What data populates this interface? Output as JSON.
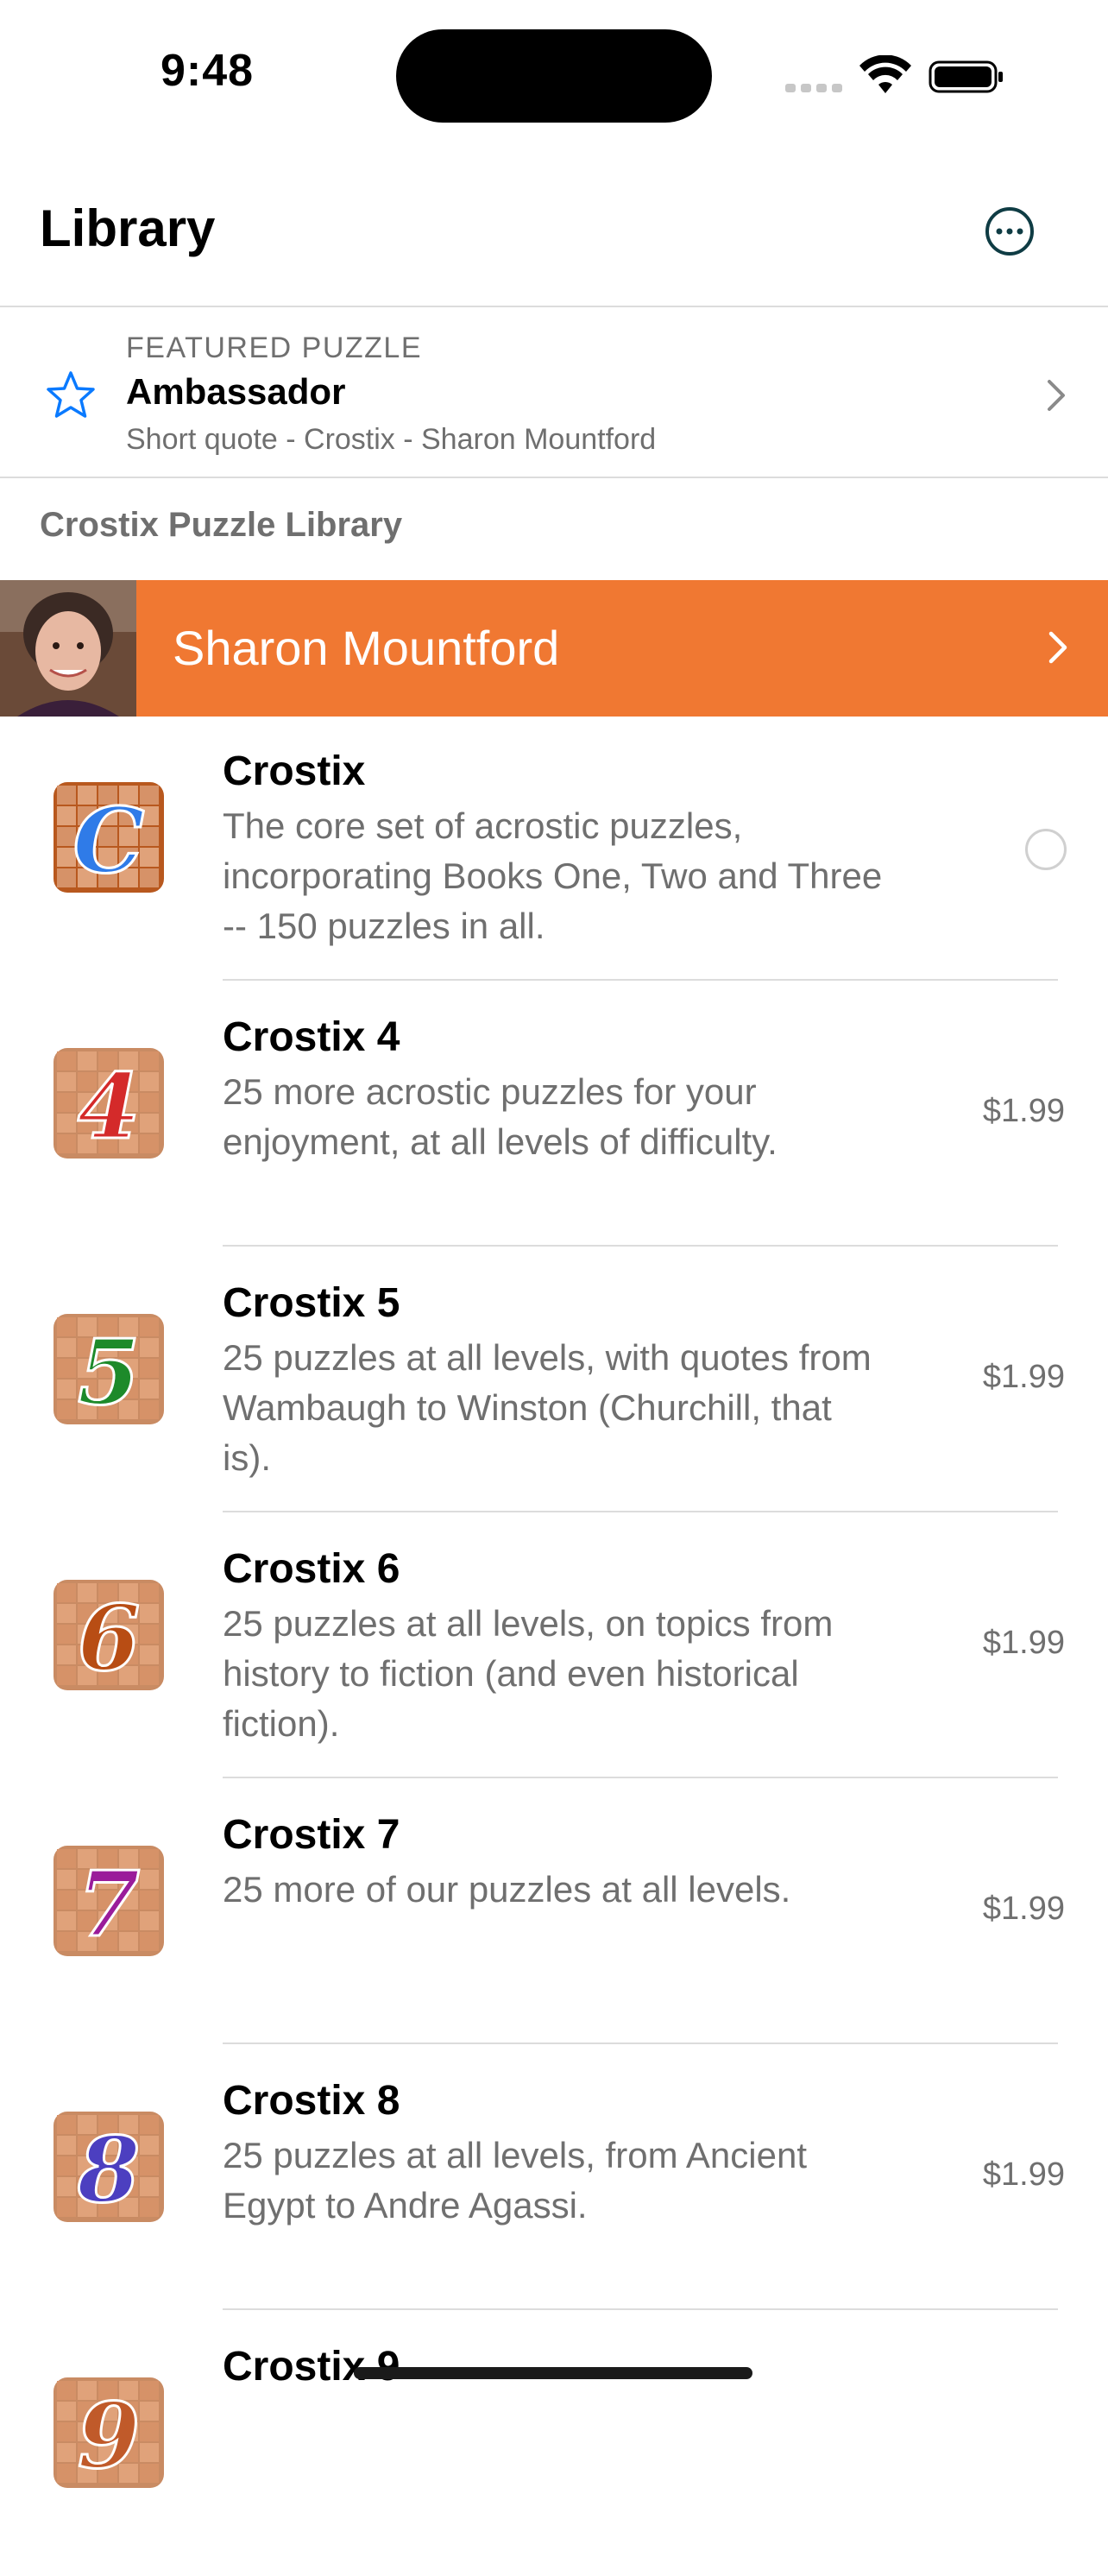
{
  "status_bar": {
    "time": "9:48"
  },
  "nav": {
    "title": "Library",
    "more_icon": "ellipsis-circle-icon"
  },
  "featured": {
    "kicker": "FEATURED PUZZLE",
    "title": "Ambassador",
    "subtitle": "Short quote - Crostix - Sharon Mountford",
    "icon": "star-icon"
  },
  "section": {
    "label": "Crostix Puzzle Library"
  },
  "author": {
    "name": "Sharon Mountford"
  },
  "colors": {
    "accent_orange": "#f07832",
    "link_blue": "#0a7aff"
  },
  "items": [
    {
      "title": "Crostix",
      "desc_lines": [
        "The core set of acrostic puzzles,",
        "incorporating Books One, Two and Three",
        "-- 150 puzzles in all."
      ],
      "price": "",
      "badge": "C",
      "badge_color": "#2f7be8"
    },
    {
      "title": "Crostix 4",
      "desc_lines": [
        "25 more acrostic puzzles for your",
        "enjoyment, at all levels of difficulty."
      ],
      "price": "$1.99",
      "badge": "4",
      "badge_color": "#d42a2a"
    },
    {
      "title": "Crostix 5",
      "desc_lines": [
        "25 puzzles at all levels, with quotes from",
        "Wambaugh to Winston (Churchill, that",
        "is)."
      ],
      "price": "$1.99",
      "badge": "5",
      "badge_color": "#1d8a2a"
    },
    {
      "title": "Crostix 6",
      "desc_lines": [
        "25 puzzles at all levels, on topics from",
        "history to fiction (and even historical",
        "fiction)."
      ],
      "price": "$1.99",
      "badge": "6",
      "badge_color": "#b84d14"
    },
    {
      "title": "Crostix 7",
      "desc_lines": [
        "25 more of our puzzles at all levels."
      ],
      "price": "$1.99",
      "badge": "7",
      "badge_color": "#9a1c9a"
    },
    {
      "title": "Crostix 8",
      "desc_lines": [
        "25 puzzles at all levels, from Ancient",
        "Egypt to Andre Agassi."
      ],
      "price": "$1.99",
      "badge": "8",
      "badge_color": "#4c3fc0"
    },
    {
      "title": "Crostix 9",
      "desc_lines": [],
      "price": "",
      "badge": "9",
      "badge_color": "#c05a2a"
    }
  ]
}
